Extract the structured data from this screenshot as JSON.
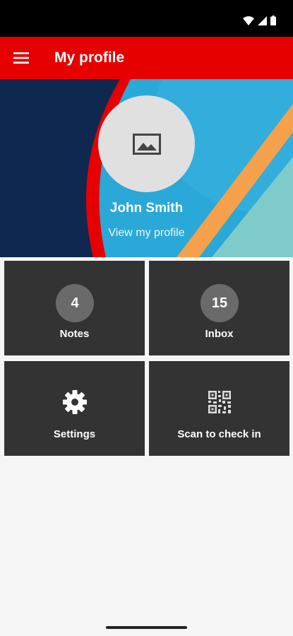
{
  "app": {
    "title": "My profile"
  },
  "status_bar": {
    "icons": [
      "wifi-icon",
      "signal-icon",
      "battery-icon"
    ]
  },
  "header": {
    "menu_icon": "hamburger-menu-icon",
    "accent_color": "#e60000"
  },
  "profile": {
    "name": "John Smith",
    "link": "View my profile",
    "avatar_icon": "image-placeholder-icon"
  },
  "tiles": [
    {
      "label": "Notes",
      "count": "4"
    },
    {
      "label": "Inbox",
      "count": "15"
    },
    {
      "label": "Settings",
      "icon": "gear-icon"
    },
    {
      "label": "Scan to check in",
      "icon": "qr-code-icon"
    }
  ],
  "colors": {
    "hero_navy": "#0f2850",
    "hero_red": "#e60000",
    "hero_blue": "#2aa8d8",
    "hero_orange": "#f5a04a",
    "hero_teal": "#7ecbc9",
    "tile_bg": "#333333",
    "badge_bg": "#6a6a6a"
  }
}
